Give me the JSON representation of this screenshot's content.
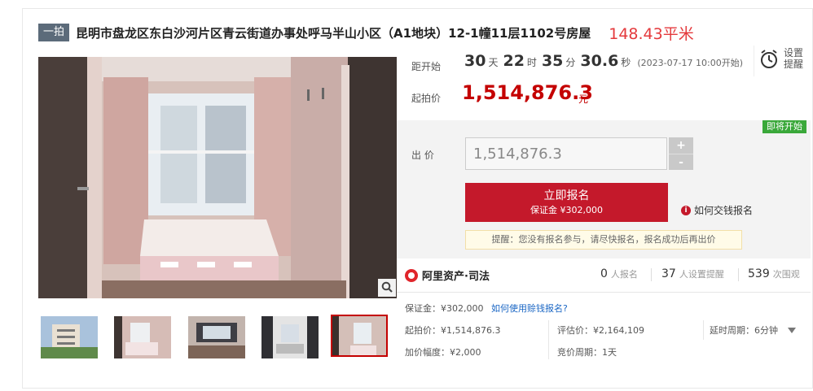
{
  "lot": {
    "tag": "一拍",
    "title": "昆明市盘龙区东白沙河片区青云街道办事处呼马半山小区（A1地块）12-1幢11层1102号房屋",
    "area": "148.43平米"
  },
  "countdown": {
    "label": "距开始",
    "days": "30",
    "days_unit": "天",
    "hours": "22",
    "hours_unit": "时",
    "minutes": "35",
    "minutes_unit": "分",
    "seconds": "30.6",
    "seconds_unit": "秒",
    "start_note": "(2023-07-17 10:00开始)"
  },
  "start_price": {
    "label": "起拍价",
    "value": "1,514,876.3",
    "unit": "元"
  },
  "remind": {
    "label": "设置提醒"
  },
  "bid": {
    "status_badge": "即将开始",
    "label": "出 价",
    "input_value": "1,514,876.3",
    "plus": "+",
    "minus": "-",
    "signup_label": "立即报名",
    "signup_deposit": "保证金 ¥302,000",
    "howpay_label": "如何交钱报名",
    "notice": "提醒：您没有报名参与，请尽快报名，报名成功后再出价"
  },
  "platform": {
    "name": "阿里资产·司法"
  },
  "stats": [
    {
      "num": "0",
      "label": "人报名"
    },
    {
      "num": "37",
      "label": "人设置提醒"
    },
    {
      "num": "539",
      "label": "次围观"
    }
  ],
  "details": {
    "deposit": "保证金：¥302,000",
    "deposit_link": "如何使用赊钱报名?",
    "start_price": "起拍价：¥1,514,876.3",
    "appraisal": "评估价：¥2,164,109",
    "delay_period": "延时周期：6分钟",
    "increment": "加价幅度：¥2,000",
    "bid_period": "竞价周期：1天"
  },
  "icons": {
    "zoom": "magnifier-icon",
    "alarm": "alarm-clock-icon",
    "info": "info-icon",
    "chevron": "chevron-down-icon"
  },
  "colors": {
    "accent_red": "#c4192b",
    "price_red": "#c40000",
    "soon_green": "#3aa83a",
    "tag_gray": "#5c6b7a"
  }
}
